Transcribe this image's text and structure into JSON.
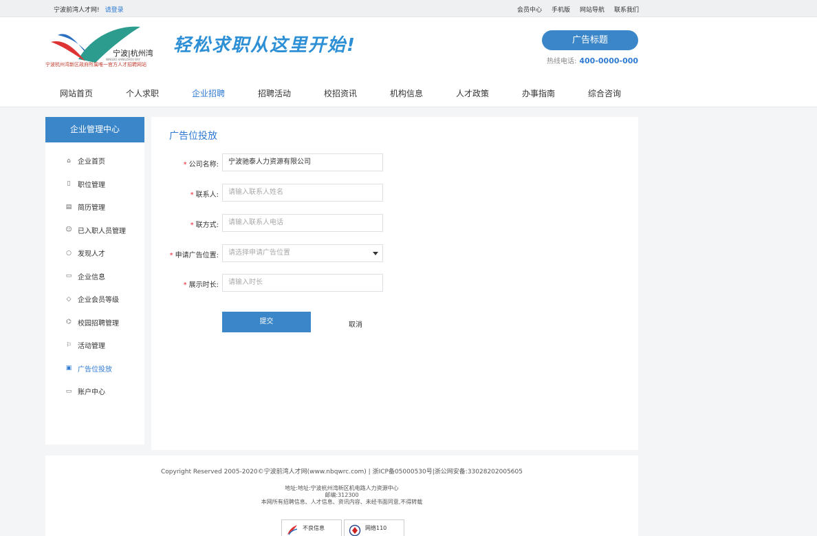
{
  "topbar": {
    "site_name": "宁波前湾人才网!",
    "login_link": "请登录",
    "links": [
      "会员中心",
      "手机版",
      "网站导航",
      "联系我们"
    ]
  },
  "header": {
    "logo_text": "宁波|杭州湾",
    "logo_sub": "NINGBO HANGZHOU BAY",
    "logo_slogan": "宁波杭州湾新区政府所属唯一官方人才招聘网站",
    "slogan": "轻松求职从这里开始!",
    "ad_button": "广告标题",
    "hotline_label": "热线电话:",
    "hotline_number": "400-0000-000"
  },
  "nav": {
    "items": [
      "网站首页",
      "个人求职",
      "企业招聘",
      "招聘活动",
      "校招资讯",
      "机构信息",
      "人才政策",
      "办事指南",
      "综合咨询"
    ],
    "active_index": 2
  },
  "sidebar": {
    "title": "企业管理中心",
    "items": [
      {
        "label": "企业首页",
        "icon": "home-icon"
      },
      {
        "label": "职位管理",
        "icon": "position-icon"
      },
      {
        "label": "简历管理",
        "icon": "resume-icon"
      },
      {
        "label": "已入职人员管理",
        "icon": "user-icon"
      },
      {
        "label": "发现人才",
        "icon": "bulb-icon"
      },
      {
        "label": "企业信息",
        "icon": "document-icon"
      },
      {
        "label": "企业会员等级",
        "icon": "diamond-icon"
      },
      {
        "label": "校园招聘管理",
        "icon": "graduation-icon"
      },
      {
        "label": "活动管理",
        "icon": "flag-icon"
      },
      {
        "label": "广告位投放",
        "icon": "ad-icon"
      },
      {
        "label": "账户中心",
        "icon": "wallet-icon"
      }
    ],
    "active_index": 9
  },
  "form": {
    "title": "广告位投放",
    "company_label": "公司名称:",
    "company_value": "宁波驰泰人力资源有限公司",
    "contact_label": "联系人:",
    "contact_placeholder": "请输入联系人姓名",
    "phone_label": "联方式:",
    "phone_placeholder": "请输入联系人电话",
    "position_label": "申请广告位置:",
    "position_placeholder": "请选择申请广告位置",
    "duration_label": "展示时长:",
    "duration_placeholder": "请输入时长",
    "submit_label": "提交",
    "cancel_label": "取消"
  },
  "footer": {
    "copyright": "Copyright Reserved 2005-2020©宁波前湾人才网(www.nbqwrc.com) | 浙ICP备05000530号|浙公网安备:33028202005605",
    "address": "地址:地址:宁波杭州湾新区机电路人力资源中心",
    "postcode": "邮编:312300",
    "notice": "本网所有招聘信息、人才信息、资讯内容、未经书面同意,不得转载",
    "badge1": "不良信息",
    "badge2": "网络110"
  },
  "colors": {
    "accent": "#3b86c9",
    "link": "#2f7bd4",
    "required": "#e22233"
  }
}
